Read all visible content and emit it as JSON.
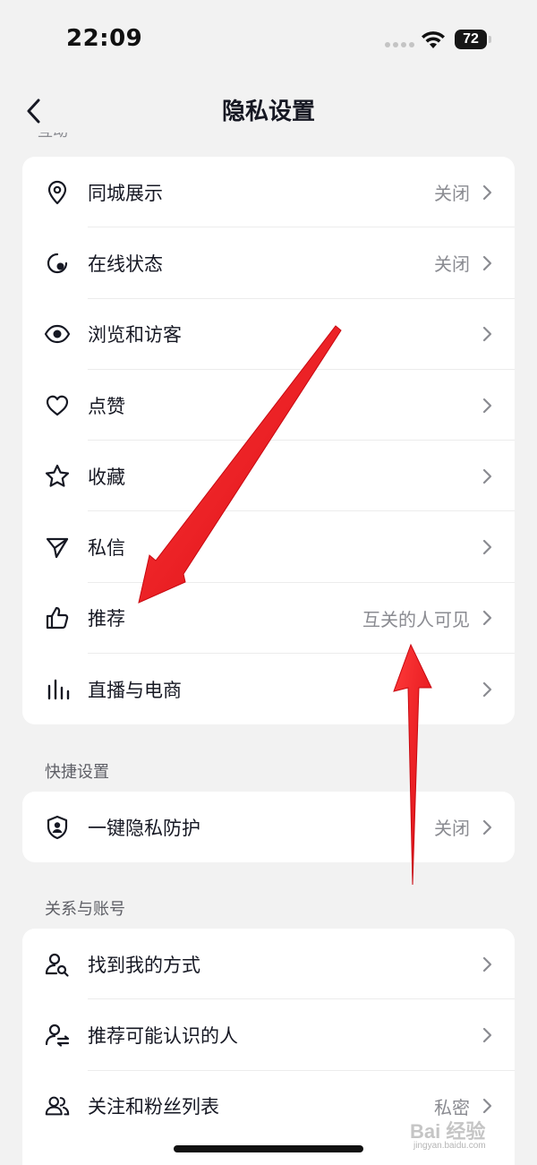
{
  "status_bar": {
    "time": "22:09",
    "battery": "72"
  },
  "header": {
    "title": "隐私设置",
    "clipped_section_label": "互动"
  },
  "sections": [
    {
      "header": "",
      "rows": [
        {
          "icon": "location-pin-icon",
          "label": "同城展示",
          "value": "关闭"
        },
        {
          "icon": "online-status-icon",
          "label": "在线状态",
          "value": "关闭"
        },
        {
          "icon": "eye-icon",
          "label": "浏览和访客",
          "value": ""
        },
        {
          "icon": "heart-icon",
          "label": "点赞",
          "value": ""
        },
        {
          "icon": "star-icon",
          "label": "收藏",
          "value": ""
        },
        {
          "icon": "send-icon",
          "label": "私信",
          "value": ""
        },
        {
          "icon": "thumbs-up-icon",
          "label": "推荐",
          "value": "互关的人可见"
        },
        {
          "icon": "bar-chart-icon",
          "label": "直播与电商",
          "value": ""
        }
      ]
    },
    {
      "header": "快捷设置",
      "rows": [
        {
          "icon": "shield-user-icon",
          "label": "一键隐私防护",
          "value": "关闭"
        }
      ]
    },
    {
      "header": "关系与账号",
      "rows": [
        {
          "icon": "user-search-icon",
          "label": "找到我的方式",
          "value": ""
        },
        {
          "icon": "user-swap-icon",
          "label": "推荐可能认识的人",
          "value": ""
        },
        {
          "icon": "users-icon",
          "label": "关注和粉丝列表",
          "value": "私密"
        }
      ]
    }
  ],
  "watermark": {
    "logo": "Bai 经验",
    "sub": "jingyan.baidu.com"
  },
  "colors": {
    "background": "#f2f2f2",
    "card": "#ffffff",
    "text": "#161823",
    "secondary": "#8a8b91",
    "arrow": "#e8141b"
  }
}
